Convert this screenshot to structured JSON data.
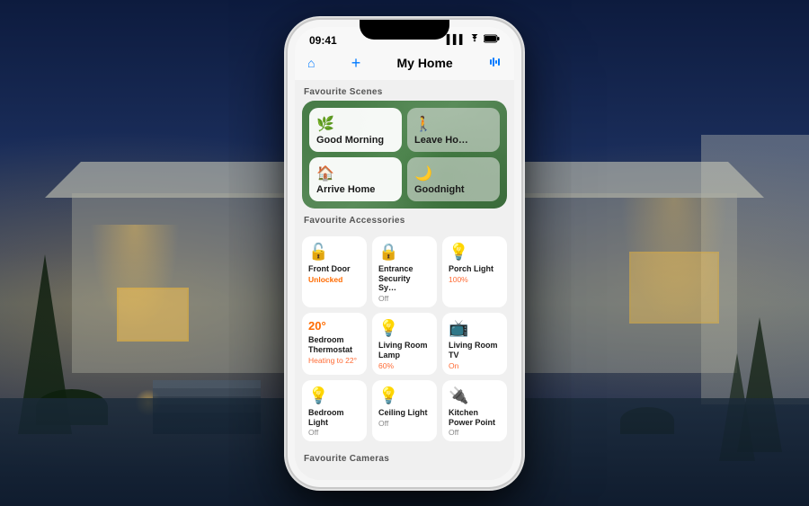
{
  "background": {
    "sky_color": "#1a2d5a"
  },
  "phone": {
    "status_bar": {
      "time": "09:41",
      "signal_icon": "▌▌▌",
      "wifi_icon": "WiFi",
      "battery_icon": "▮▮▮▮"
    },
    "nav": {
      "home_icon": "⌂",
      "add_icon": "+",
      "title": "My Home",
      "audio_icon": "≋"
    },
    "scenes": {
      "section_label": "Favourite Scenes",
      "items": [
        {
          "name": "Good Morning",
          "icon": "🌿",
          "active": true
        },
        {
          "name": "Leave Ho…",
          "icon": "🚶",
          "active": false
        },
        {
          "name": "Arrive Home",
          "icon": "🏠",
          "active": true
        },
        {
          "name": "Goodnight",
          "icon": "🌙",
          "active": false
        }
      ]
    },
    "accessories": {
      "section_label": "Favourite Accessories",
      "rows": [
        [
          {
            "name": "Front Door",
            "icon": "🔓",
            "status": "Unlocked",
            "status_type": "unlocked"
          },
          {
            "name": "Entrance Security Sy…",
            "icon": "🔒",
            "status": "Off",
            "status_type": "off"
          },
          {
            "name": "Porch Light",
            "icon": "💡",
            "status": "100%",
            "status_type": "on"
          }
        ],
        [
          {
            "name": "Bedroom Thermostat",
            "icon": "🌡",
            "status": "Heating to 22°",
            "status_type": "on",
            "badge": "20°"
          },
          {
            "name": "Living Room Lamp",
            "icon": "💡",
            "status": "60%",
            "status_type": "on"
          },
          {
            "name": "Living Room TV",
            "icon": "📺",
            "status": "On",
            "status_type": "on"
          }
        ],
        [
          {
            "name": "Bedroom Light",
            "icon": "💡",
            "status": "Off",
            "status_type": "off"
          },
          {
            "name": "Ceiling Light",
            "icon": "💡",
            "status": "Off",
            "status_type": "off"
          },
          {
            "name": "Kitchen Power Point",
            "icon": "🔌",
            "status": "Off",
            "status_type": "off"
          }
        ]
      ]
    },
    "cameras": {
      "section_label": "Favourite Cameras"
    }
  }
}
